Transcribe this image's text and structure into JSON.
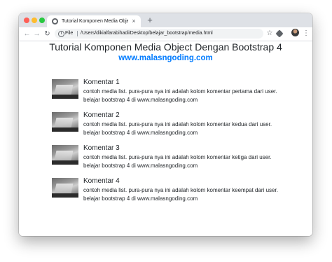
{
  "browser": {
    "tab_title": "Tutorial Komponen Media Obje",
    "tab_close": "×",
    "new_tab": "+",
    "back": "←",
    "forward": "→",
    "reload": "↻",
    "info": "i",
    "file_label": "File",
    "url": "/Users/dikialfarabihadi/Desktop/belajar_bootstrap/media.html",
    "star": "☆",
    "menu": "⋮",
    "icons": [
      "back-arrow-icon",
      "forward-arrow-icon",
      "reload-icon",
      "info-icon",
      "star-icon",
      "extension-icon",
      "profile-avatar",
      "more-menu-icon"
    ]
  },
  "page": {
    "title": "Tutorial Komponen Media Object Dengan Bootstrap 4",
    "site": "www.malasngoding.com",
    "link_color": "#007bff",
    "comments": [
      {
        "title": "Komentar 1",
        "line1": "contoh media list. pura-pura nya ini adalah kolom komentar pertama dari user.",
        "line2": "belajar bootstrap 4 di www.malasngoding.com"
      },
      {
        "title": "Komentar 2",
        "line1": "contoh media list. pura-pura nya ini adalah kolom komentar kedua dari user.",
        "line2": "belajar bootstrap 4 di www.malasngoding.com"
      },
      {
        "title": "Komentar 3",
        "line1": "contoh media list. pura-pura nya ini adalah kolom komentar ketiga dari user.",
        "line2": "belajar bootstrap 4 di www.malasngoding.com"
      },
      {
        "title": "Komentar 4",
        "line1": "contoh media list. pura-pura nya ini adalah kolom komentar keempat dari user.",
        "line2": "belajar bootstrap 4 di www.malasngoding.com"
      }
    ]
  }
}
